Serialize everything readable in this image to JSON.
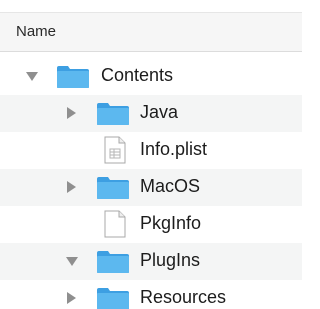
{
  "columns": {
    "name_label": "Name"
  },
  "colors": {
    "folder_blue": "#5cb8ef",
    "folder_blue_dark": "#3d9fe2",
    "disclosure_gray": "#8f8f8f",
    "row_stripe": "#f4f5f5"
  },
  "items": [
    {
      "name": "Contents",
      "kind": "folder",
      "expanded": true,
      "icon": "folder-icon"
    },
    {
      "name": "Java",
      "kind": "folder",
      "expanded": false,
      "icon": "folder-icon"
    },
    {
      "name": "Info.plist",
      "kind": "file",
      "icon": "plist-file-icon"
    },
    {
      "name": "MacOS",
      "kind": "folder",
      "expanded": false,
      "icon": "folder-icon"
    },
    {
      "name": "PkgInfo",
      "kind": "file",
      "icon": "blank-file-icon"
    },
    {
      "name": "PlugIns",
      "kind": "folder",
      "expanded": true,
      "icon": "folder-icon"
    },
    {
      "name": "Resources",
      "kind": "folder",
      "expanded": false,
      "icon": "folder-icon"
    }
  ]
}
